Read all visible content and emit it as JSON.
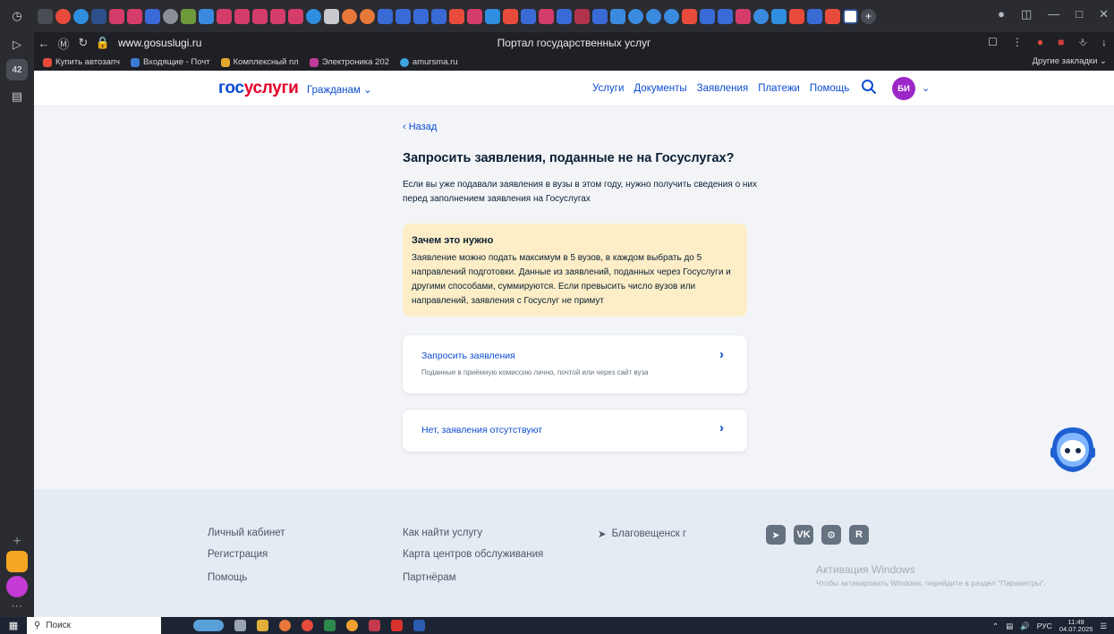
{
  "browser": {
    "url": "www.gosuslugi.ru",
    "page_title": "Портал государственных услуг",
    "bookmarks": [
      {
        "label": "Купить автозапч",
        "color": "#e84b3c"
      },
      {
        "label": "Входящие - Почт",
        "color": "#3a7bd5"
      },
      {
        "label": "Комплексный пл",
        "color": "#e0a82e"
      },
      {
        "label": "Электроника 202",
        "color": "#c03a9c"
      },
      {
        "label": "amursma.ru",
        "color": "#3aa5e0"
      }
    ],
    "other_bookmarks": "Другие закладки",
    "side_badge": "42"
  },
  "header": {
    "logo_part1": "гос",
    "logo_part2": "услуги",
    "persona": "Гражданам",
    "nav": [
      "Услуги",
      "Документы",
      "Заявления",
      "Платежи",
      "Помощь"
    ],
    "avatar_initials": "БИ"
  },
  "main": {
    "back": "Назад",
    "title": "Запросить заявления, поданные не на Госуслугах?",
    "intro": "Если вы уже подавали заявления в вузы в этом году, нужно получить сведения о них перед заполнением заявления на Госуслугах",
    "info": {
      "title": "Зачем это нужно",
      "text": "Заявление можно подать максимум в 5 вузов, в каждом выбрать до 5 направлений подготовки. Данные из заявлений, поданных через Госуслуги и другими способами, суммируются. Если превысить число вузов или направлений, заявления с Госуслуг не примут"
    },
    "option_request": {
      "title": "Запросить заявления",
      "subtitle": "Поданные в приёмную комиссию лично, почтой или через сайт вуза"
    },
    "option_none": {
      "title": "Нет, заявления отсутствуют"
    }
  },
  "footer": {
    "col1": [
      "Личный кабинет",
      "Регистрация",
      "Помощь"
    ],
    "col2": [
      "Как найти услугу",
      "Карта центров обслуживания",
      "Партнёрам"
    ],
    "location": "Благовещенск г",
    "social": [
      "telegram-icon",
      "vk-icon",
      "odnoklassniki-icon",
      "rutube-icon"
    ]
  },
  "windows_activation": {
    "title": "Активация Windows",
    "subtitle": "Чтобы активировать Windows, перейдите в раздел \"Параметры\"."
  },
  "taskbar": {
    "search_placeholder": "Поиск",
    "lang": "РУС",
    "time": "11:49",
    "date": "04.07.2025"
  },
  "colors": {
    "brand_blue": "#0d4cd3",
    "brand_red": "#e4002b",
    "info_bg": "#fdeec7",
    "page_bg": "#f2f4f8",
    "footer_bg": "#e4ebf3",
    "avatar_bg": "#9b27c8"
  }
}
